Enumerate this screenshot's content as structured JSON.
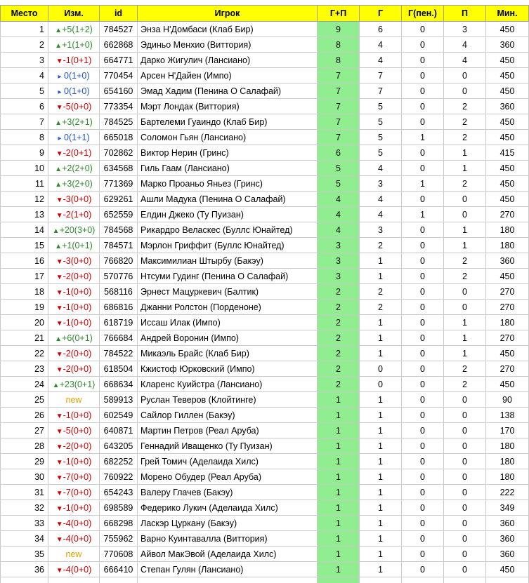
{
  "headers": {
    "place": "Место",
    "change": "Изм.",
    "id": "id",
    "player": "Игрок",
    "gp": "Г+П",
    "g": "Г",
    "gpen": "Г(пен.)",
    "p": "П",
    "min": "Мин."
  },
  "colors": {
    "header_bg": "#ffff00",
    "gp_bg": "#90ee90",
    "up": "#2e8b2e",
    "down": "#cc0000",
    "same": "#2255cc",
    "new": "#e0a000"
  },
  "icons": {
    "up": "triangle-up-icon",
    "down": "triangle-down-icon",
    "same": "triangle-right-icon"
  },
  "rows": [
    {
      "place": "1",
      "dir": "up",
      "change": "+5(1+2)",
      "id": "784527",
      "player": "Энза Н'Домбаси (Клаб Бир)",
      "gp": "9",
      "g": "6",
      "gpen": "0",
      "p": "3",
      "min": "450"
    },
    {
      "place": "2",
      "dir": "up",
      "change": "+1(1+0)",
      "id": "662868",
      "player": "Эдиньо Менхио (Виттория)",
      "gp": "8",
      "g": "4",
      "gpen": "0",
      "p": "4",
      "min": "360"
    },
    {
      "place": "3",
      "dir": "down",
      "change": "-1(0+1)",
      "id": "664771",
      "player": "Дарко Жигулич (Лансиано)",
      "gp": "8",
      "g": "4",
      "gpen": "0",
      "p": "4",
      "min": "450"
    },
    {
      "place": "4",
      "dir": "same",
      "change": "0(1+0)",
      "id": "770454",
      "player": "Арсен Н'Дайен (Импо)",
      "gp": "7",
      "g": "7",
      "gpen": "0",
      "p": "0",
      "min": "450"
    },
    {
      "place": "5",
      "dir": "same",
      "change": "0(1+0)",
      "id": "654160",
      "player": "Эмад Хадим (Пенина О Салафай)",
      "gp": "7",
      "g": "7",
      "gpen": "0",
      "p": "0",
      "min": "450"
    },
    {
      "place": "6",
      "dir": "down",
      "change": "-5(0+0)",
      "id": "773354",
      "player": "Мэрт Лондак (Виттория)",
      "gp": "7",
      "g": "5",
      "gpen": "0",
      "p": "2",
      "min": "360"
    },
    {
      "place": "7",
      "dir": "up",
      "change": "+3(2+1)",
      "id": "784525",
      "player": "Бартелеми Гуаиндо (Клаб Бир)",
      "gp": "7",
      "g": "5",
      "gpen": "0",
      "p": "2",
      "min": "450"
    },
    {
      "place": "8",
      "dir": "same",
      "change": "0(1+1)",
      "id": "665018",
      "player": "Соломон Гьян (Лансиано)",
      "gp": "7",
      "g": "5",
      "gpen": "1",
      "p": "2",
      "min": "450"
    },
    {
      "place": "9",
      "dir": "down",
      "change": "-2(0+1)",
      "id": "702862",
      "player": "Виктор Нерин (Гринс)",
      "gp": "6",
      "g": "5",
      "gpen": "0",
      "p": "1",
      "min": "415"
    },
    {
      "place": "10",
      "dir": "up",
      "change": "+2(2+0)",
      "id": "634568",
      "player": "Гиль Гаам (Лансиано)",
      "gp": "5",
      "g": "4",
      "gpen": "0",
      "p": "1",
      "min": "450"
    },
    {
      "place": "11",
      "dir": "up",
      "change": "+3(2+0)",
      "id": "771369",
      "player": "Марко Проаньо Яньез (Гринс)",
      "gp": "5",
      "g": "3",
      "gpen": "1",
      "p": "2",
      "min": "450"
    },
    {
      "place": "12",
      "dir": "down",
      "change": "-3(0+0)",
      "id": "629261",
      "player": "Ашли Мадука (Пенина О Салафай)",
      "gp": "4",
      "g": "4",
      "gpen": "0",
      "p": "0",
      "min": "450"
    },
    {
      "place": "13",
      "dir": "down",
      "change": "-2(1+0)",
      "id": "652559",
      "player": "Елдин Джеко (Ту Пуизан)",
      "gp": "4",
      "g": "4",
      "gpen": "1",
      "p": "0",
      "min": "270"
    },
    {
      "place": "14",
      "dir": "up",
      "change": "+20(3+0)",
      "id": "784568",
      "player": "Рикардро Веласкес (Буллс Юнайтед)",
      "gp": "4",
      "g": "3",
      "gpen": "0",
      "p": "1",
      "min": "180"
    },
    {
      "place": "15",
      "dir": "up",
      "change": "+1(0+1)",
      "id": "784571",
      "player": "Мэрлон Гриффит (Буллс Юнайтед)",
      "gp": "3",
      "g": "2",
      "gpen": "0",
      "p": "1",
      "min": "180"
    },
    {
      "place": "16",
      "dir": "down",
      "change": "-3(0+0)",
      "id": "766820",
      "player": "Максимилиан Штырбу (Бакэу)",
      "gp": "3",
      "g": "1",
      "gpen": "0",
      "p": "2",
      "min": "360"
    },
    {
      "place": "17",
      "dir": "down",
      "change": "-2(0+0)",
      "id": "570776",
      "player": "Нтсуми Гудинг (Пенина О Салафай)",
      "gp": "3",
      "g": "1",
      "gpen": "0",
      "p": "2",
      "min": "450"
    },
    {
      "place": "18",
      "dir": "down",
      "change": "-1(0+0)",
      "id": "568116",
      "player": "Эрнест Мацуркевич (Балтик)",
      "gp": "2",
      "g": "2",
      "gpen": "0",
      "p": "0",
      "min": "270"
    },
    {
      "place": "19",
      "dir": "down",
      "change": "-1(0+0)",
      "id": "686816",
      "player": "Джанни Ролстон (Порденоне)",
      "gp": "2",
      "g": "2",
      "gpen": "0",
      "p": "0",
      "min": "270"
    },
    {
      "place": "20",
      "dir": "down",
      "change": "-1(0+0)",
      "id": "618719",
      "player": "Иссаш Илак (Импо)",
      "gp": "2",
      "g": "1",
      "gpen": "0",
      "p": "1",
      "min": "180"
    },
    {
      "place": "21",
      "dir": "up",
      "change": "+6(0+1)",
      "id": "766684",
      "player": "Андрей Воронин (Импо)",
      "gp": "2",
      "g": "1",
      "gpen": "0",
      "p": "1",
      "min": "270"
    },
    {
      "place": "22",
      "dir": "down",
      "change": "-2(0+0)",
      "id": "784522",
      "player": "Микаэль Брайс (Клаб Бир)",
      "gp": "2",
      "g": "1",
      "gpen": "0",
      "p": "1",
      "min": "450"
    },
    {
      "place": "23",
      "dir": "down",
      "change": "-2(0+0)",
      "id": "618504",
      "player": "Кжистоф Юрковский (Импо)",
      "gp": "2",
      "g": "0",
      "gpen": "0",
      "p": "2",
      "min": "270"
    },
    {
      "place": "24",
      "dir": "up",
      "change": "+23(0+1)",
      "id": "668634",
      "player": "Кларенс Куийстра (Лансиано)",
      "gp": "2",
      "g": "0",
      "gpen": "0",
      "p": "2",
      "min": "450"
    },
    {
      "place": "25",
      "dir": "new",
      "change": "new",
      "id": "589913",
      "player": "Руслан Теверов (Клойтинге)",
      "gp": "1",
      "g": "1",
      "gpen": "0",
      "p": "0",
      "min": "90"
    },
    {
      "place": "26",
      "dir": "down",
      "change": "-1(0+0)",
      "id": "602549",
      "player": "Сайлор Гиллен (Бакэу)",
      "gp": "1",
      "g": "1",
      "gpen": "0",
      "p": "0",
      "min": "138"
    },
    {
      "place": "27",
      "dir": "down",
      "change": "-5(0+0)",
      "id": "640871",
      "player": "Мартин Петров (Реал Аруба)",
      "gp": "1",
      "g": "1",
      "gpen": "0",
      "p": "0",
      "min": "170"
    },
    {
      "place": "28",
      "dir": "down",
      "change": "-2(0+0)",
      "id": "643205",
      "player": "Геннадий Иващенко (Ту Пуизан)",
      "gp": "1",
      "g": "1",
      "gpen": "0",
      "p": "0",
      "min": "180"
    },
    {
      "place": "29",
      "dir": "down",
      "change": "-1(0+0)",
      "id": "682252",
      "player": "Грей Томич (Аделаида Хилс)",
      "gp": "1",
      "g": "1",
      "gpen": "0",
      "p": "0",
      "min": "180"
    },
    {
      "place": "30",
      "dir": "down",
      "change": "-7(0+0)",
      "id": "760922",
      "player": "Морено Обудер (Реал Аруба)",
      "gp": "1",
      "g": "1",
      "gpen": "0",
      "p": "0",
      "min": "180"
    },
    {
      "place": "31",
      "dir": "down",
      "change": "-7(0+0)",
      "id": "654243",
      "player": "Валеру Глачев (Бакэу)",
      "gp": "1",
      "g": "1",
      "gpen": "0",
      "p": "0",
      "min": "222"
    },
    {
      "place": "32",
      "dir": "down",
      "change": "-1(0+0)",
      "id": "698589",
      "player": "Федерико Лукич (Аделаида Хилс)",
      "gp": "1",
      "g": "1",
      "gpen": "0",
      "p": "0",
      "min": "349"
    },
    {
      "place": "33",
      "dir": "down",
      "change": "-4(0+0)",
      "id": "668298",
      "player": "Ласкэр Цуркану (Бакэу)",
      "gp": "1",
      "g": "1",
      "gpen": "0",
      "p": "0",
      "min": "360"
    },
    {
      "place": "34",
      "dir": "down",
      "change": "-4(0+0)",
      "id": "755962",
      "player": "Варно Куинтавалла (Виттория)",
      "gp": "1",
      "g": "1",
      "gpen": "0",
      "p": "0",
      "min": "360"
    },
    {
      "place": "35",
      "dir": "new",
      "change": "new",
      "id": "770608",
      "player": "Айвол МакЭвой (Аделаида Хилс)",
      "gp": "1",
      "g": "1",
      "gpen": "0",
      "p": "0",
      "min": "360"
    },
    {
      "place": "36",
      "dir": "down",
      "change": "-4(0+0)",
      "id": "666410",
      "player": "Степан Гулян (Лансиано)",
      "gp": "1",
      "g": "1",
      "gpen": "0",
      "p": "0",
      "min": "450"
    }
  ]
}
